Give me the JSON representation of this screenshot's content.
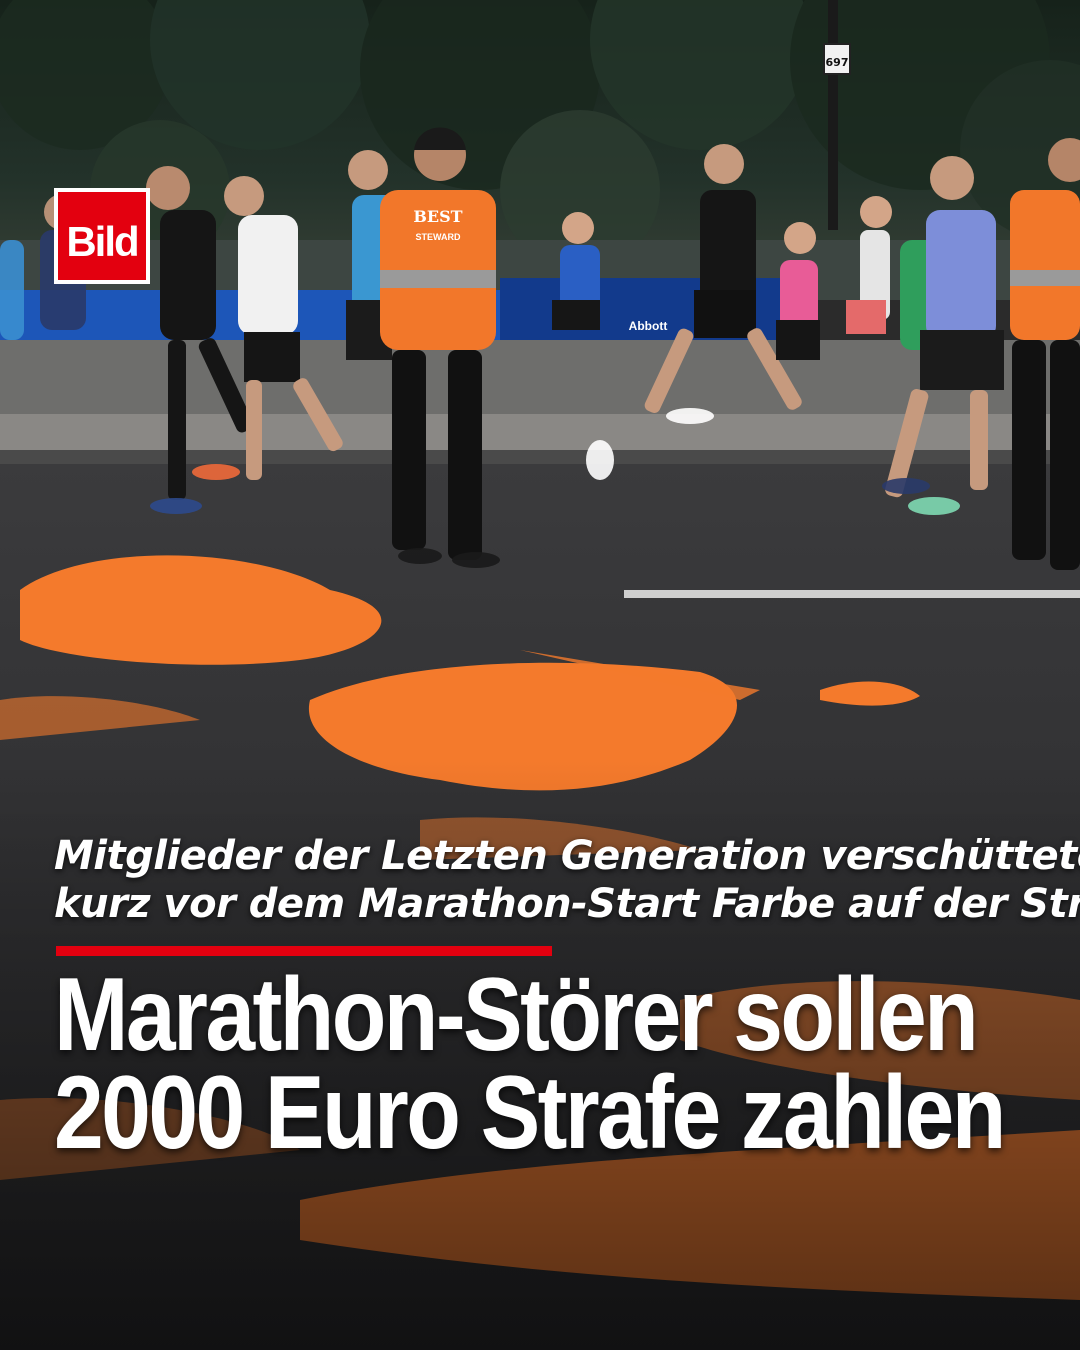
{
  "brand": {
    "logo_text": "Bild",
    "logo_color": "#e3000f"
  },
  "photo": {
    "banner_brands": [
      "Abbott"
    ],
    "vest_text": "BEST",
    "vest_role": "STEWARD",
    "sign_number": "697",
    "paint_color": "#f47a2c"
  },
  "article": {
    "kicker_line1": "Mitglieder der Letzten Generation verschütteten",
    "kicker_line2": "kurz vor dem Marathon-Start Farbe auf der Strecke",
    "headline_line1": "Marathon-Störer sollen",
    "headline_line2": "2000 Euro Strafe zahlen",
    "accent_color": "#e3000f"
  }
}
